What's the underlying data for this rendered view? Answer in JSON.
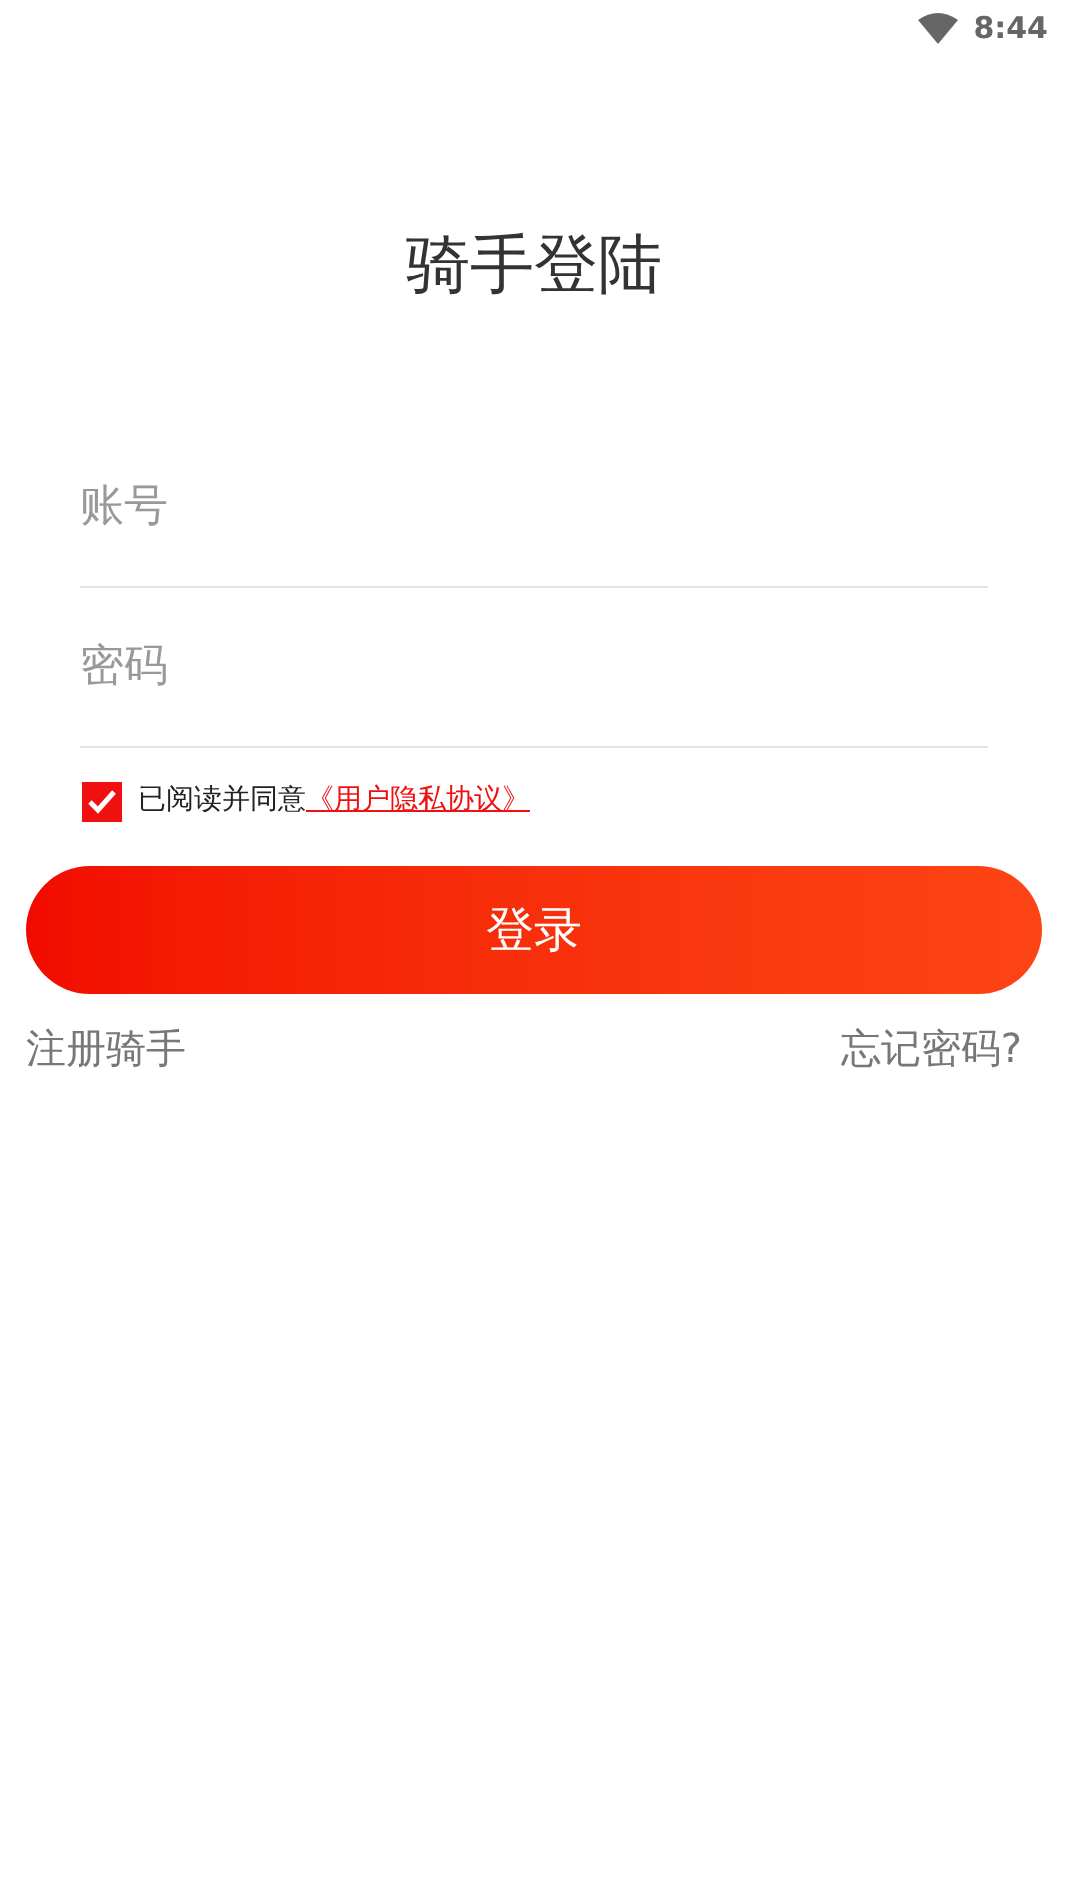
{
  "status_bar": {
    "time": "8:44"
  },
  "title": "骑手登陆",
  "fields": [
    {
      "placeholder": "账号"
    },
    {
      "placeholder": "密码"
    }
  ],
  "agreement": {
    "checked": true,
    "text": "已阅读并同意",
    "link": "《用户隐私协议》"
  },
  "login_button": "登录",
  "links": {
    "register": "注册骑手",
    "forgot": "忘记密码?"
  }
}
